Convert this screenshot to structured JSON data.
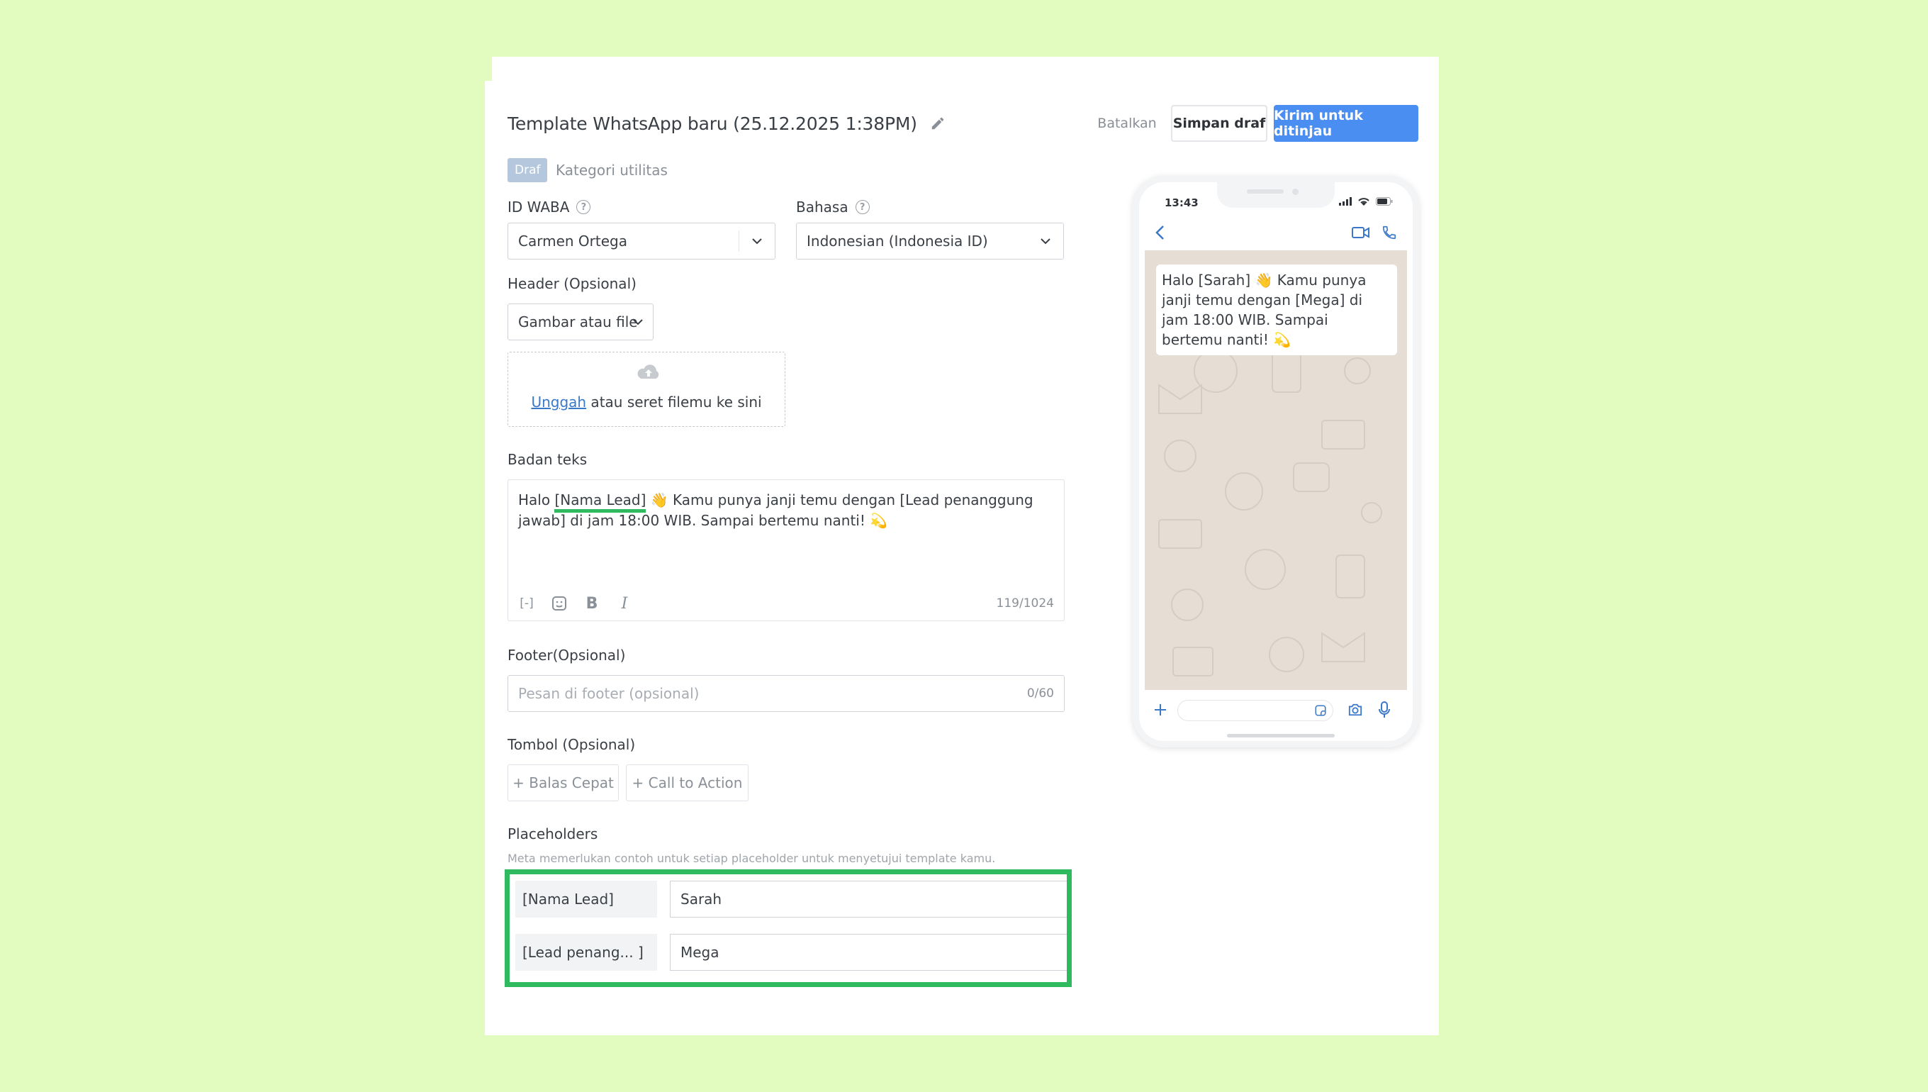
{
  "header": {
    "title": "Template WhatsApp baru (25.12.2025 1:38PM)",
    "cancel_label": "Batalkan",
    "save_draft_label": "Simpan draf",
    "submit_label": "Kirim untuk ditinjau",
    "status_badge": "Draf",
    "category": "Kategori utilitas"
  },
  "fields": {
    "waba_label": "ID WABA",
    "waba_value": "Carmen Ortega",
    "language_label": "Bahasa",
    "language_value": "Indonesian (Indonesia ID)",
    "header_label": "Header (Opsional)",
    "header_type": "Gambar atau file",
    "upload_link": "Unggah",
    "upload_text": " atau seret filemu ke sini",
    "body_label": "Badan teks",
    "body_parts": {
      "p1": "Halo ",
      "ph1": "[Nama Lead]",
      "p2": " 👋 Kamu punya janji temu dengan ",
      "ph2": "[Lead penanggung jawab]",
      "p3": " di jam 18:00 WIB. Sampai bertemu nanti! 💫"
    },
    "body_count": "119/1024",
    "footer_label": "Footer(Opsional)",
    "footer_placeholder": "Pesan di footer (opsional)",
    "footer_count": "0/60",
    "buttons_label": "Tombol (Opsional)",
    "quick_reply_label": "+ Balas Cepat",
    "cta_label": "+ Call to Action",
    "placeholders_label": "Placeholders",
    "placeholders_hint": "Meta memerlukan contoh untuk setiap placeholder untuk menyetujui template kamu.",
    "placeholders": [
      {
        "key": "[Nama Lead]",
        "value": "Sarah"
      },
      {
        "key": "[Lead penang... ]",
        "value": "Mega"
      }
    ]
  },
  "preview": {
    "time": "13:43",
    "message": "Halo [Sarah] 👋 Kamu punya janji temu dengan [Mega] di jam 18:00 WIB. Sampai bertemu nanti! 💫"
  },
  "colors": {
    "background": "#e2fcc0",
    "accent": "#4a8ef2",
    "highlight": "#2fba5f",
    "badge": "#b4c7dc"
  },
  "icons": [
    "pencil-icon",
    "help-icon",
    "chevron-down-icon",
    "cloud-upload-icon",
    "variable-icon",
    "sticker-icon",
    "bold-icon",
    "italic-icon",
    "back-icon",
    "video-icon",
    "phone-icon",
    "plus-icon",
    "camera-icon",
    "mic-icon"
  ]
}
